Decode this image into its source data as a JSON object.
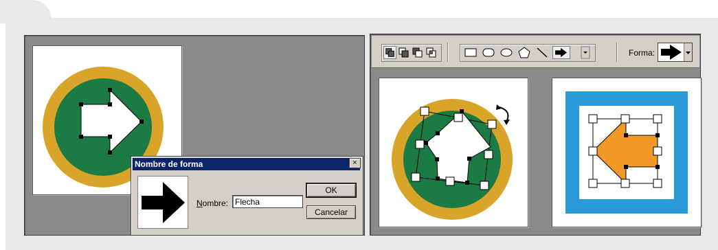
{
  "dialog": {
    "title": "Nombre de forma",
    "close_glyph": "×",
    "name_label_mnemonic": "N",
    "name_label_rest": "ombre:",
    "name_value": "Flecha",
    "ok_label": "OK",
    "cancel_label": "Cancelar"
  },
  "toolbar": {
    "shape_label": "Forma:",
    "mode_icons": [
      "new-shape-icon",
      "add-to-shape-icon",
      "subtract-shape-icon",
      "intersect-shape-icon"
    ],
    "tool_icons": [
      "rectangle-icon",
      "rounded-rectangle-icon",
      "ellipse-icon",
      "polygon-icon",
      "line-icon",
      "custom-shape-arrow-icon"
    ]
  },
  "colors": {
    "ring": "#d8a42a",
    "disc": "#1c7a45",
    "arrow_orange": "#f19a2a",
    "frame_blue": "#2a9ad8",
    "workspace": "#8a8a8a",
    "dialog_title": "#0a246a"
  }
}
